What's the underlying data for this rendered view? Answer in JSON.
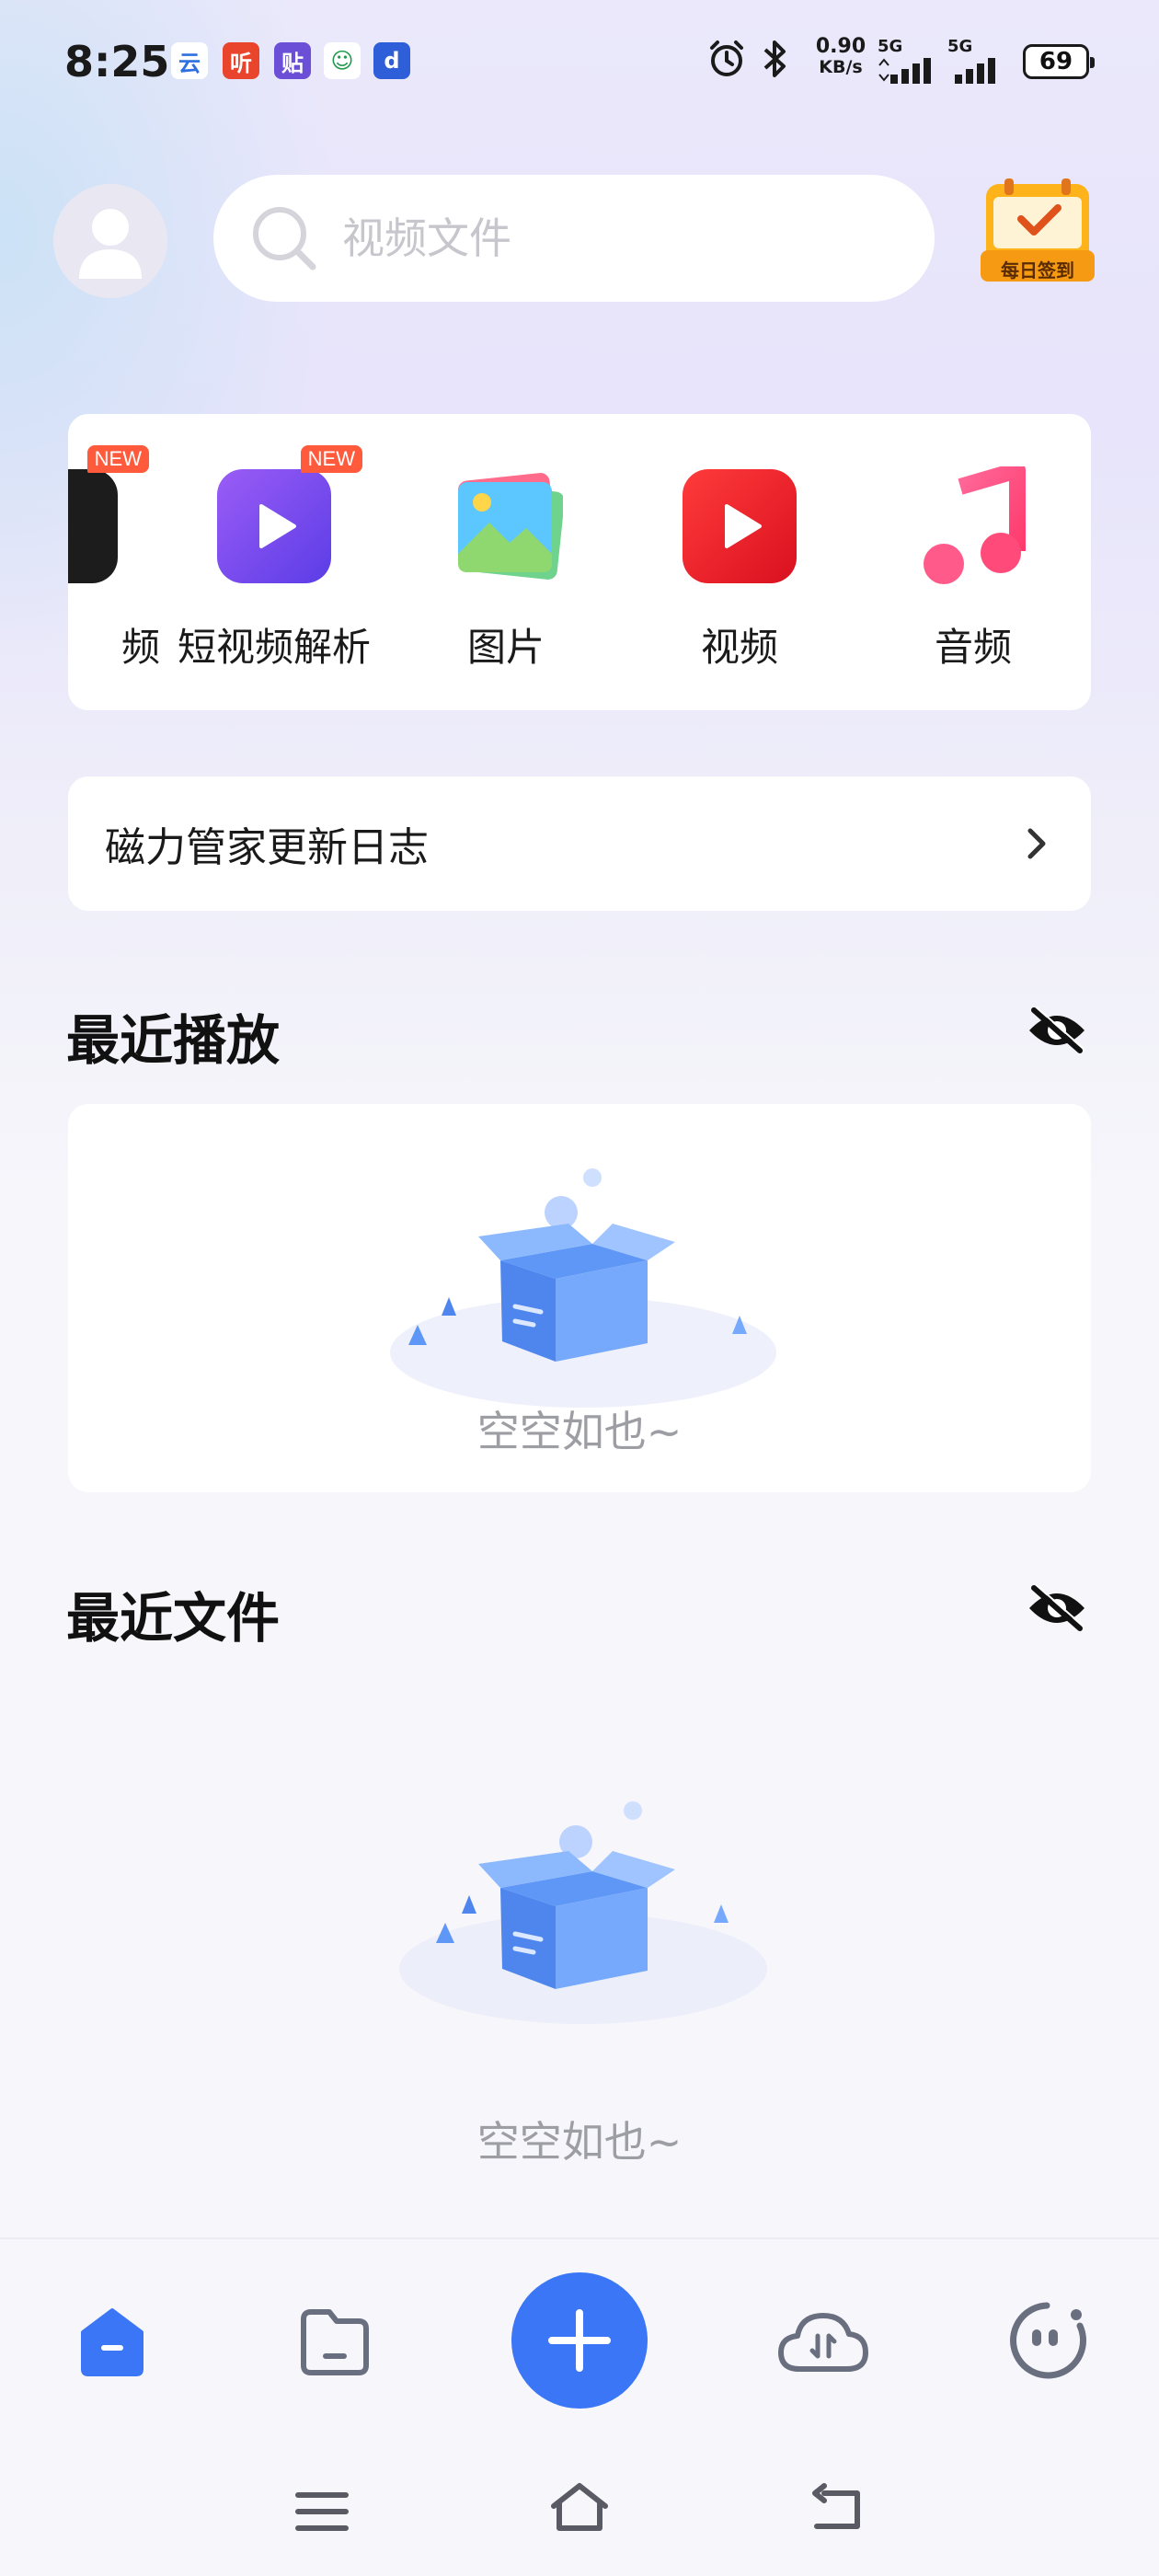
{
  "status_bar": {
    "time": "8:25",
    "apps": [
      {
        "icon": "yun-app-icon",
        "glyph": "云",
        "color": "#2f6fe0",
        "bg": "#ffffff"
      },
      {
        "icon": "ting-app-icon",
        "glyph": "听",
        "color": "#ffffff",
        "bg": "#e8452c"
      },
      {
        "icon": "tie-app-icon",
        "glyph": "贴",
        "color": "#ffffff",
        "bg": "#6b4fd6"
      },
      {
        "icon": "green-app-icon",
        "glyph": "☺",
        "color": "#1f9a4a",
        "bg": "#ffffff"
      },
      {
        "icon": "blue-app-icon",
        "glyph": "d",
        "color": "#ffffff",
        "bg": "#2f5fd8"
      }
    ],
    "net_speed_value": "0.90",
    "net_speed_unit": "KB/s",
    "sim1_label": "5G",
    "sim2_label": "5G",
    "battery": "69"
  },
  "header": {
    "search_placeholder": "视频文件",
    "checkin_label": "每日签到"
  },
  "quick_items": [
    {
      "label": "频",
      "icon": "partial-video-icon",
      "new": "NEW"
    },
    {
      "label": "短视频解析",
      "icon": "short-video-parse-icon",
      "new": "NEW"
    },
    {
      "label": "图片",
      "icon": "image-icon",
      "new": ""
    },
    {
      "label": "视频",
      "icon": "video-icon",
      "new": ""
    },
    {
      "label": "音频",
      "icon": "audio-icon",
      "new": ""
    }
  ],
  "changelog": {
    "label": "磁力管家更新日志"
  },
  "recent_play": {
    "title": "最近播放",
    "empty_text": "空空如也~"
  },
  "recent_files": {
    "title": "最近文件",
    "empty_text": "空空如也~"
  },
  "colors": {
    "accent": "#3b76f6",
    "nav_inactive": "#6a6f80"
  }
}
